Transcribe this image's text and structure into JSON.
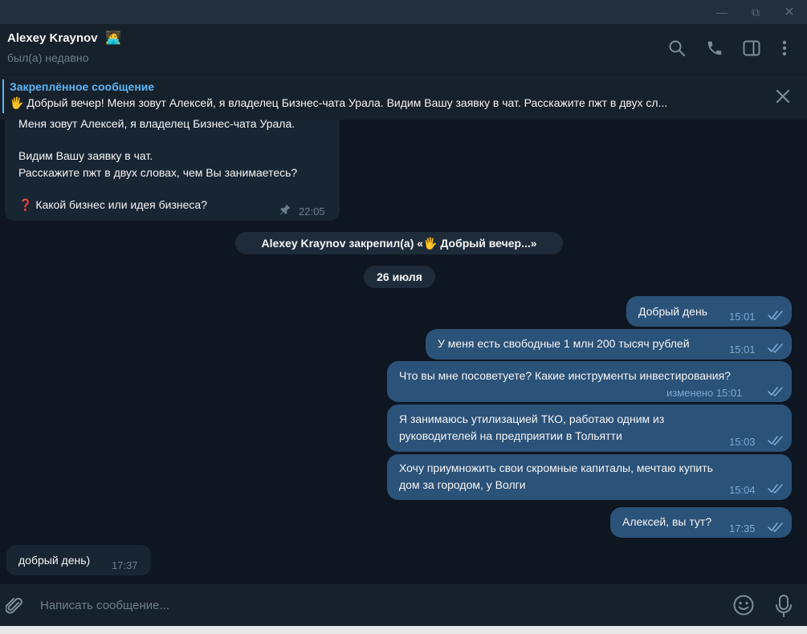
{
  "window": {
    "minimize": "—",
    "restore": "⧉",
    "close": "✕"
  },
  "header": {
    "name": "Alexey Kraynov",
    "name_emoji": "🧑‍💻",
    "status": "был(а) недавно"
  },
  "pinned": {
    "title": "Закреплённое сообщение",
    "text": "🖐 Добрый вечер!  Меня зовут Алексей, я владелец Бизнес-чата Урала.  Видим Вашу заявку в чат. Расскажите пжт в двух сл..."
  },
  "messages": {
    "first": {
      "line1": "Меня зовут Алексей, я владелец Бизнес-чата Урала.",
      "line2": "Видим Вашу заявку в чат.",
      "line3": "Расскажите пжт в двух словах, чем Вы занимаетесь?",
      "line4": "❓ Какой бизнес или идея бизнеса?",
      "time": "22:05"
    },
    "service_pin": "Alexey Kraynov закрепил(а) «🖐 Добрый вечер...»",
    "date": "26 июля",
    "m1": {
      "text": "Добрый день",
      "time": "15:01"
    },
    "m2": {
      "text": "У меня есть свободные 1 млн 200 тысяч рублей",
      "time": "15:01"
    },
    "m3": {
      "text": "Что вы мне посоветуете? Какие инструменты инвестирования?",
      "time": "изменено 15:01"
    },
    "m4": {
      "line1": "Я занимаюсь утилизацией ТКО, работаю одним из",
      "line2": "руководителей на предприятии в Тольятти",
      "time": "15:03"
    },
    "m5": {
      "line1": "Хочу приумножить свои скромные капиталы, мечтаю купить",
      "line2": "дом за городом, у Волги",
      "time": "15:04"
    },
    "m6": {
      "text": "Алексей, вы тут?",
      "time": "17:35"
    },
    "reply": {
      "text": "добрый день)",
      "time": "17:37"
    }
  },
  "composer": {
    "placeholder": "Написать сообщение..."
  },
  "colors": {
    "bg": "#0e1621",
    "panel": "#17212b",
    "out_bubble": "#2b5278",
    "in_bubble": "#182533",
    "accent": "#5eb5f7"
  }
}
